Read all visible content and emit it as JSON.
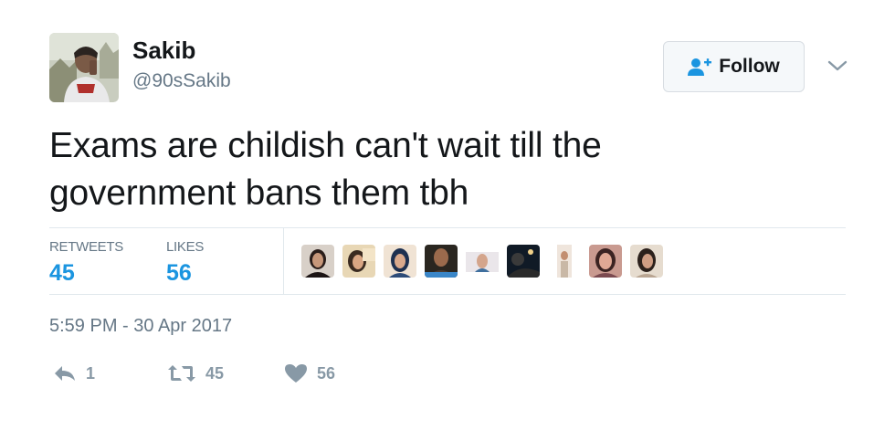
{
  "author": {
    "name": "Sakib",
    "handle": "@90sSakib"
  },
  "follow_button": {
    "label": "Follow",
    "icon": "add-person-icon"
  },
  "tweet": {
    "text_line1": "Exams are childish can't wait till the",
    "text_line2": "government bans them tbh"
  },
  "stats": {
    "retweets_label": "RETWEETS",
    "retweets_count": "45",
    "likes_label": "LIKES",
    "likes_count": "56"
  },
  "timestamp": "5:59 PM - 30 Apr 2017",
  "actions": {
    "reply_count": "1",
    "retweet_count": "45",
    "like_count": "56"
  },
  "colors": {
    "accent": "#1b95e0",
    "muted": "#657786",
    "icon_gray": "#8899a6",
    "divider": "#e1e8ed"
  }
}
